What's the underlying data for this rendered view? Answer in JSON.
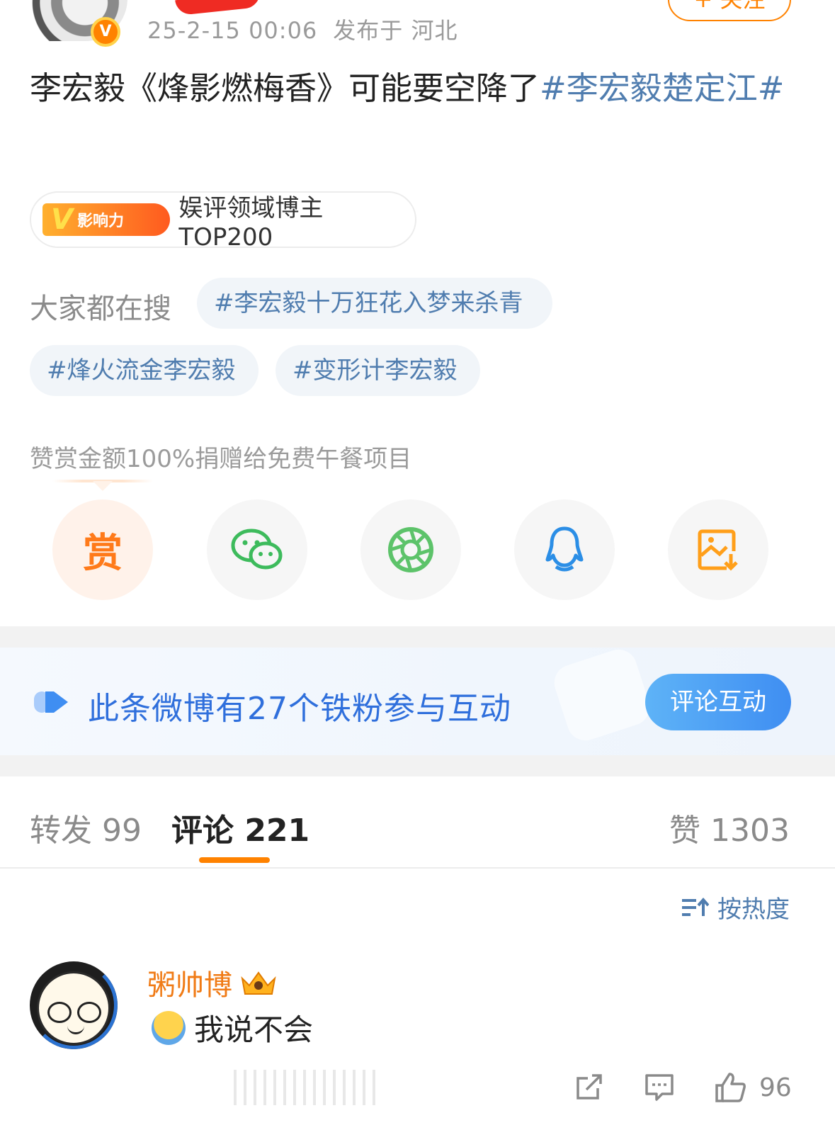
{
  "post": {
    "timestamp": "25-2-15 00:06",
    "location": "发布于 河北",
    "follow_label": "+ 关注",
    "text_main": "李宏毅《烽影燃梅香》可能要空降了",
    "text_topic": "#李宏毅楚定江#"
  },
  "influence": {
    "logo_letter": "V",
    "logo_text": "影响力",
    "label": "娱评领域博主TOP200"
  },
  "search": {
    "label": "大家都在搜",
    "tags": [
      "#李宏毅十万狂花入梦来杀青",
      "#烽火流金李宏毅",
      "#变形计李宏毅"
    ]
  },
  "reward": {
    "note": "赞赏金额100%捐赠给免费午餐项目",
    "reward_label": "赏"
  },
  "share_icons": [
    "reward-icon",
    "wechat-icon",
    "moments-icon",
    "qq-icon",
    "save-image-icon"
  ],
  "fans": {
    "text": "此条微博有27个铁粉参与互动",
    "button": "评论互动"
  },
  "tabs": {
    "repost": "转发 99",
    "comments": "评论 221",
    "likes": "赞 1303"
  },
  "sort_label": "按热度",
  "comment": {
    "username": "粥帅博",
    "text": "我说不会",
    "like_count": "96"
  },
  "colors": {
    "accent": "#ff8200",
    "link": "#507daf",
    "fans_blue": "#2f6fdc",
    "username_orange": "#f07b16"
  }
}
